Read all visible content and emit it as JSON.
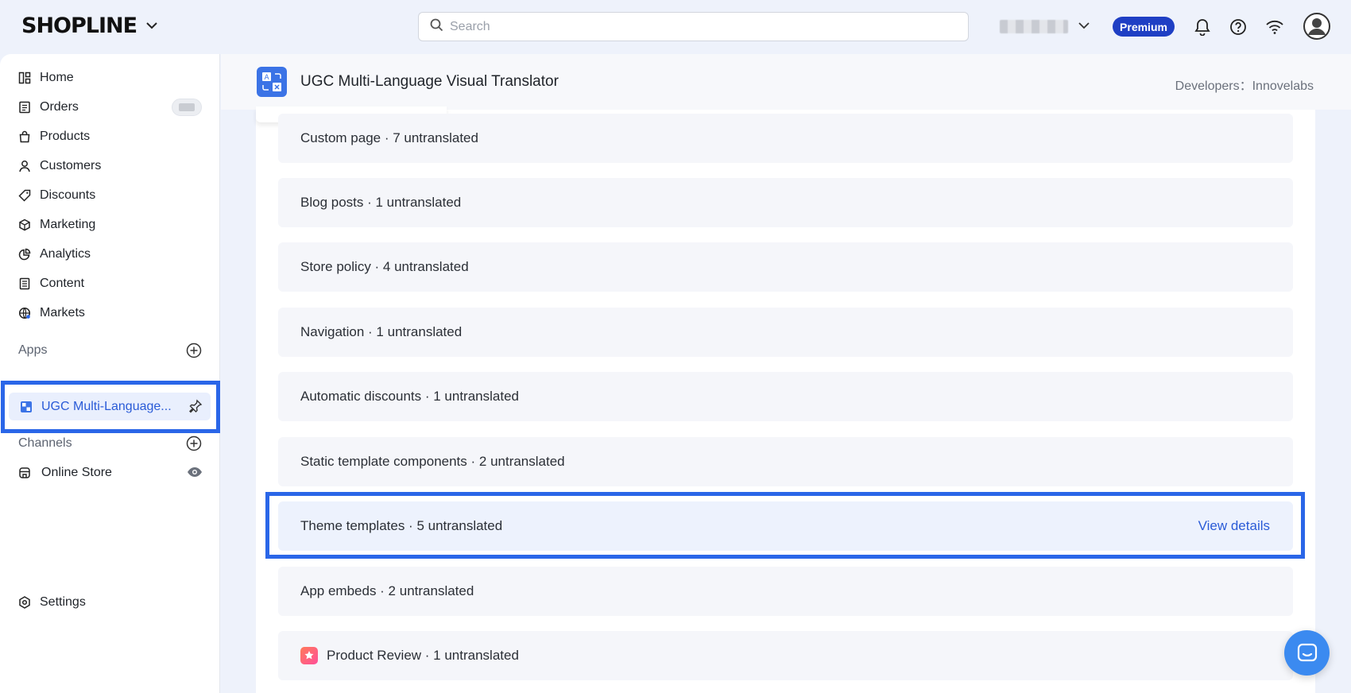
{
  "brand": {
    "logo_text": "SHOPLINE"
  },
  "search": {
    "placeholder": "Search"
  },
  "header": {
    "premium_label": "Premium"
  },
  "sidebar": {
    "items": [
      {
        "label": "Home",
        "icon": "home-icon"
      },
      {
        "label": "Orders",
        "icon": "orders-icon"
      },
      {
        "label": "Products",
        "icon": "products-icon"
      },
      {
        "label": "Customers",
        "icon": "customers-icon"
      },
      {
        "label": "Discounts",
        "icon": "discounts-icon"
      },
      {
        "label": "Marketing",
        "icon": "marketing-icon"
      },
      {
        "label": "Analytics",
        "icon": "analytics-icon"
      },
      {
        "label": "Content",
        "icon": "content-icon"
      },
      {
        "label": "Markets",
        "icon": "markets-icon"
      }
    ],
    "apps_label": "Apps",
    "active_app": "UGC Multi-Language...",
    "channels_label": "Channels",
    "online_store": "Online Store",
    "settings": "Settings"
  },
  "app": {
    "title": "UGC Multi-Language Visual Translator",
    "developers": "Developers：Innovelabs"
  },
  "resources": [
    {
      "label": "Custom page · 7 untranslated"
    },
    {
      "label": "Blog posts · 1 untranslated"
    },
    {
      "label": "Store policy · 4 untranslated"
    },
    {
      "label": "Navigation · 1 untranslated"
    },
    {
      "label": "Automatic discounts · 1 untranslated"
    },
    {
      "label": "Static template components · 2 untranslated"
    },
    {
      "label": "Theme templates · 5 untranslated",
      "action": "View details"
    },
    {
      "label": "App embeds · 2 untranslated"
    },
    {
      "label": "Product Review · 1 untranslated"
    }
  ],
  "colors": {
    "accent": "#2a66e8",
    "premium": "#1f3fc4",
    "link": "#2a5bd7"
  }
}
